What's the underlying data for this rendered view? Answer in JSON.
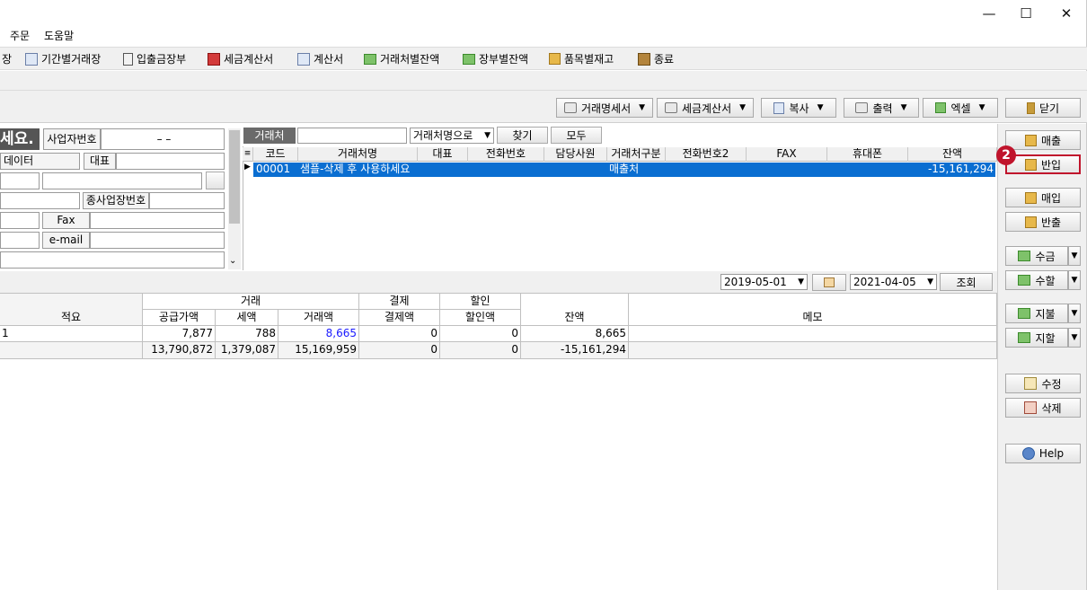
{
  "menu": {
    "items": [
      "주문",
      "도움말"
    ]
  },
  "toolbar": {
    "items": [
      {
        "label": "장",
        "icon": "ledger-icon"
      },
      {
        "label": "기간별거래장",
        "icon": "window-icon"
      },
      {
        "label": "입출금장부",
        "icon": "calculator-icon"
      },
      {
        "label": "세금계산서",
        "icon": "invoice-icon"
      },
      {
        "label": "계산서",
        "icon": "document-icon"
      },
      {
        "label": "거래처별잔액",
        "icon": "money-icon"
      },
      {
        "label": "장부별잔액",
        "icon": "money-icon"
      },
      {
        "label": "품목별재고",
        "icon": "box-icon"
      },
      {
        "label": "종료",
        "icon": "exit-icon"
      }
    ]
  },
  "actions": {
    "statement": "거래명세서",
    "tax_invoice": "세금계산서",
    "copy": "복사",
    "print": "출력",
    "excel": "엑셀",
    "close": "닫기"
  },
  "left_form": {
    "heading": "세요.",
    "biz_no_label": "사업자번호",
    "biz_no_value": "–   –",
    "data_label": "데이터",
    "rep_label": "대표",
    "sub_biz_label": "종사업장번호",
    "fax_label": "Fax",
    "email_label": "e-mail"
  },
  "search": {
    "tab_label": "거래처",
    "mode_value": "거래처명으로",
    "find_button": "찾기",
    "all_button": "모두"
  },
  "client_grid": {
    "columns": [
      "코드",
      "거래처명",
      "대표",
      "전화번호",
      "담당사원",
      "거래처구분",
      "전화번호2",
      "FAX",
      "휴대폰",
      "잔액"
    ],
    "rows": [
      {
        "code": "00001",
        "name": "샘플-삭제 후 사용하세요",
        "rep": "",
        "phone": "",
        "staff": "",
        "type": "매출처",
        "phone2": "",
        "fax": "",
        "mobile": "",
        "balance": "-15,161,294"
      }
    ]
  },
  "date_filter": {
    "from": "2019-05-01",
    "to": "2021-04-05",
    "query_button": "조회"
  },
  "ledger": {
    "group_headers": {
      "trade": "거래",
      "payment": "결제",
      "discount": "할인"
    },
    "columns": [
      "적요",
      "공급가액",
      "세액",
      "거래액",
      "결제액",
      "할인액",
      "잔액",
      "메모"
    ],
    "rows": [
      {
        "memo_summary": "1",
        "supply": "7,877",
        "tax": "788",
        "amount": "8,665",
        "paid": "0",
        "discount": "0",
        "balance": "8,665",
        "memo": ""
      }
    ],
    "totals": {
      "supply": "13,790,872",
      "tax": "1,379,087",
      "amount": "15,169,959",
      "paid": "0",
      "discount": "0",
      "balance": "-15,161,294"
    }
  },
  "side_panel": {
    "sales": "매출",
    "sales_return": "반입",
    "purchase": "매입",
    "purchase_return": "반출",
    "receive": "수금",
    "receive_discount": "수할",
    "pay": "지불",
    "pay_discount": "지할",
    "edit": "수정",
    "delete": "삭제",
    "help": "Help",
    "step_badge": "2"
  },
  "colors": {
    "selection": "#0a6ed1",
    "highlight_border": "#c0142c",
    "badge": "#c0142c",
    "link_value": "#1a1aff"
  }
}
